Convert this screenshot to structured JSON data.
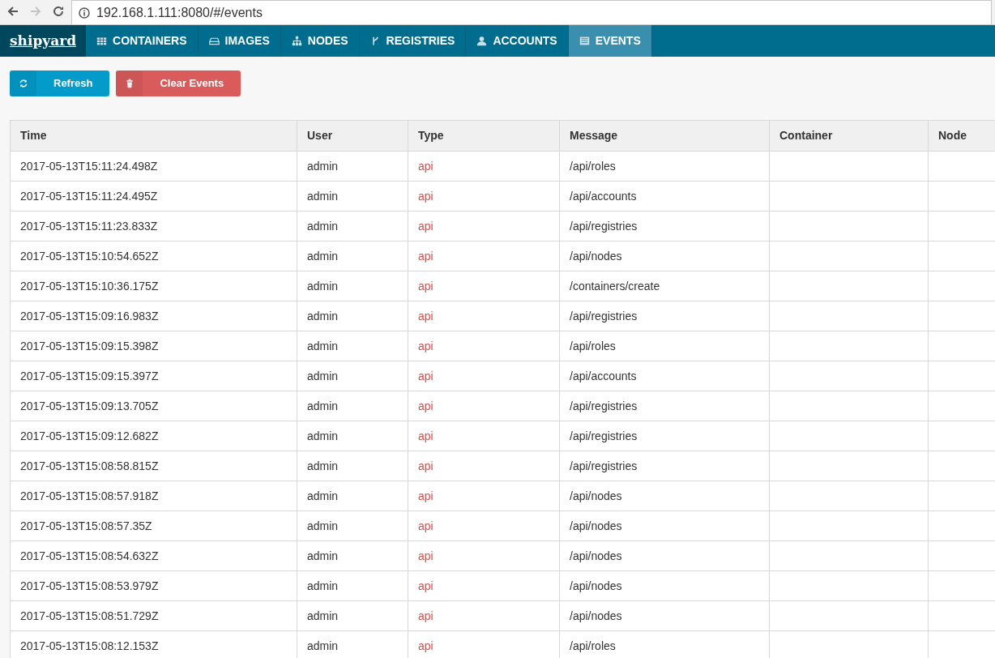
{
  "browser": {
    "url": "192.168.1.111:8080/#/events",
    "back_disabled": false,
    "forward_disabled": true
  },
  "navbar": {
    "brand": "shipyard",
    "items": [
      {
        "label": "CONTAINERS",
        "selected": false
      },
      {
        "label": "IMAGES",
        "selected": false
      },
      {
        "label": "NODES",
        "selected": false
      },
      {
        "label": "REGISTRIES",
        "selected": false
      },
      {
        "label": "ACCOUNTS",
        "selected": false
      },
      {
        "label": "EVENTS",
        "selected": true
      }
    ]
  },
  "actions": [
    {
      "label": "Refresh",
      "kind": "info"
    },
    {
      "label": "Clear Events",
      "kind": "danger"
    }
  ],
  "table": {
    "columns": [
      "Time",
      "User",
      "Type",
      "Message",
      "Container",
      "Node"
    ],
    "rows": [
      [
        "2017-05-13T15:11:24.498Z",
        "admin",
        "api",
        "/api/roles"
      ],
      [
        "2017-05-13T15:11:24.495Z",
        "admin",
        "api",
        "/api/accounts"
      ],
      [
        "2017-05-13T15:11:23.833Z",
        "admin",
        "api",
        "/api/registries"
      ],
      [
        "2017-05-13T15:10:54.652Z",
        "admin",
        "api",
        "/api/nodes"
      ],
      [
        "2017-05-13T15:10:36.175Z",
        "admin",
        "api",
        "/containers/create"
      ],
      [
        "2017-05-13T15:09:16.983Z",
        "admin",
        "api",
        "/api/registries"
      ],
      [
        "2017-05-13T15:09:15.398Z",
        "admin",
        "api",
        "/api/roles"
      ],
      [
        "2017-05-13T15:09:15.397Z",
        "admin",
        "api",
        "/api/accounts"
      ],
      [
        "2017-05-13T15:09:13.705Z",
        "admin",
        "api",
        "/api/registries"
      ],
      [
        "2017-05-13T15:09:12.682Z",
        "admin",
        "api",
        "/api/registries"
      ],
      [
        "2017-05-13T15:08:58.815Z",
        "admin",
        "api",
        "/api/registries"
      ],
      [
        "2017-05-13T15:08:57.918Z",
        "admin",
        "api",
        "/api/nodes"
      ],
      [
        "2017-05-13T15:08:57.35Z",
        "admin",
        "api",
        "/api/nodes"
      ],
      [
        "2017-05-13T15:08:54.632Z",
        "admin",
        "api",
        "/api/nodes"
      ],
      [
        "2017-05-13T15:08:53.979Z",
        "admin",
        "api",
        "/api/nodes"
      ],
      [
        "2017-05-13T15:08:51.729Z",
        "admin",
        "api",
        "/api/nodes"
      ],
      [
        "2017-05-13T15:08:12.153Z",
        "admin",
        "api",
        "/api/roles"
      ]
    ]
  }
}
